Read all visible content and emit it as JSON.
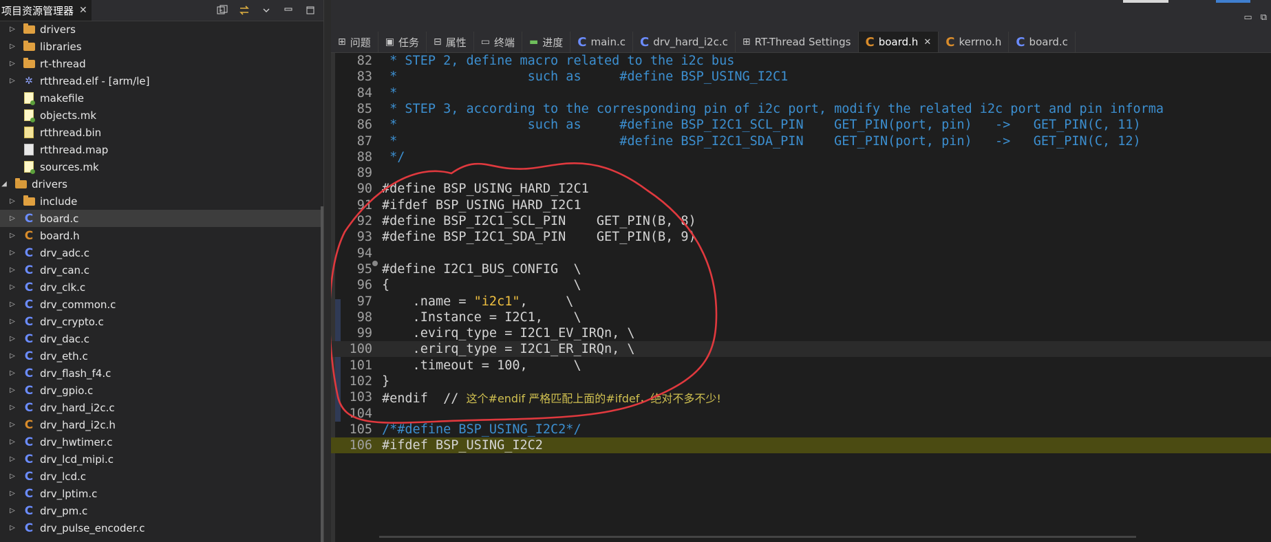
{
  "left_panel": {
    "title": "项目资源管理器",
    "close": "✕",
    "tree": [
      {
        "label": "drivers",
        "icon": "folder-icon",
        "indent": 1,
        "twisty": "▷"
      },
      {
        "label": "libraries",
        "icon": "folder-icon",
        "indent": 1,
        "twisty": "▷"
      },
      {
        "label": "rt-thread",
        "icon": "folder-icon",
        "indent": 1,
        "twisty": "▷"
      },
      {
        "label": "rtthread.elf - [arm/le]",
        "icon": "bug-icon",
        "indent": 1,
        "twisty": "▷"
      },
      {
        "label": "makefile",
        "icon": "makefile-icon",
        "indent": 1,
        "twisty": ""
      },
      {
        "label": "objects.mk",
        "icon": "makefile-icon",
        "indent": 1,
        "twisty": ""
      },
      {
        "label": "rtthread.bin",
        "icon": "bin-file-icon",
        "indent": 1,
        "twisty": ""
      },
      {
        "label": "rtthread.map",
        "icon": "map-file-icon",
        "indent": 1,
        "twisty": ""
      },
      {
        "label": "sources.mk",
        "icon": "makefile-icon",
        "indent": 1,
        "twisty": ""
      },
      {
        "label": "drivers",
        "icon": "folder-open-icon",
        "indent": 0,
        "twisty": "◢"
      },
      {
        "label": "include",
        "icon": "folder-icon",
        "indent": 1,
        "twisty": "▷"
      },
      {
        "label": "board.c",
        "icon": "c-file-icon",
        "indent": 1,
        "twisty": "▷",
        "selected": true
      },
      {
        "label": "board.h",
        "icon": "h-file-icon",
        "indent": 1,
        "twisty": "▷"
      },
      {
        "label": "drv_adc.c",
        "icon": "c-file-icon",
        "indent": 1,
        "twisty": "▷"
      },
      {
        "label": "drv_can.c",
        "icon": "c-file-icon",
        "indent": 1,
        "twisty": "▷"
      },
      {
        "label": "drv_clk.c",
        "icon": "c-file-icon",
        "indent": 1,
        "twisty": "▷"
      },
      {
        "label": "drv_common.c",
        "icon": "c-file-icon",
        "indent": 1,
        "twisty": "▷"
      },
      {
        "label": "drv_crypto.c",
        "icon": "c-file-icon",
        "indent": 1,
        "twisty": "▷"
      },
      {
        "label": "drv_dac.c",
        "icon": "c-file-icon",
        "indent": 1,
        "twisty": "▷"
      },
      {
        "label": "drv_eth.c",
        "icon": "c-file-icon",
        "indent": 1,
        "twisty": "▷"
      },
      {
        "label": "drv_flash_f4.c",
        "icon": "c-file-icon",
        "indent": 1,
        "twisty": "▷"
      },
      {
        "label": "drv_gpio.c",
        "icon": "c-file-icon",
        "indent": 1,
        "twisty": "▷"
      },
      {
        "label": "drv_hard_i2c.c",
        "icon": "c-file-icon",
        "indent": 1,
        "twisty": "▷"
      },
      {
        "label": "drv_hard_i2c.h",
        "icon": "h-file-icon",
        "indent": 1,
        "twisty": "▷"
      },
      {
        "label": "drv_hwtimer.c",
        "icon": "c-file-icon",
        "indent": 1,
        "twisty": "▷"
      },
      {
        "label": "drv_lcd_mipi.c",
        "icon": "c-file-icon",
        "indent": 1,
        "twisty": "▷"
      },
      {
        "label": "drv_lcd.c",
        "icon": "c-file-icon",
        "indent": 1,
        "twisty": "▷"
      },
      {
        "label": "drv_lptim.c",
        "icon": "c-file-icon",
        "indent": 1,
        "twisty": "▷"
      },
      {
        "label": "drv_pm.c",
        "icon": "c-file-icon",
        "indent": 1,
        "twisty": "▷"
      },
      {
        "label": "drv_pulse_encoder.c",
        "icon": "c-file-icon",
        "indent": 1,
        "twisty": "▷"
      }
    ]
  },
  "tabs": [
    {
      "label": "问题",
      "icon": "problems-icon",
      "glyph": "⊞"
    },
    {
      "label": "任务",
      "icon": "tasks-icon",
      "glyph": "▣"
    },
    {
      "label": "属性",
      "icon": "properties-icon",
      "glyph": "⊟"
    },
    {
      "label": "终端",
      "icon": "terminal-icon",
      "glyph": "▭"
    },
    {
      "label": "进度",
      "icon": "progress-icon",
      "glyph": "▬"
    },
    {
      "label": "main.c",
      "icon": "c-file-icon",
      "glyph": "C"
    },
    {
      "label": "drv_hard_i2c.c",
      "icon": "c-file-icon",
      "glyph": "C"
    },
    {
      "label": "RT-Thread Settings",
      "icon": "settings-icon",
      "glyph": "⊞"
    },
    {
      "label": "board.h",
      "icon": "h-file-icon",
      "glyph": "C",
      "active": true,
      "close": "✕"
    },
    {
      "label": "kerrno.h",
      "icon": "h-file-icon",
      "glyph": "C"
    },
    {
      "label": "board.c",
      "icon": "c-file-icon",
      "glyph": "C"
    }
  ],
  "editor": {
    "lines": [
      {
        "num": "82",
        "text": " * STEP 2, define macro related to the i2c bus",
        "type": "comment"
      },
      {
        "num": "83",
        "text": " *                 such as     #define BSP_USING_I2C1",
        "type": "comment"
      },
      {
        "num": "84",
        "text": " *",
        "type": "comment"
      },
      {
        "num": "85",
        "text": " * STEP 3, according to the corresponding pin of i2c port, modify the related i2c port and pin informa",
        "type": "comment"
      },
      {
        "num": "86",
        "text": " *                 such as     #define BSP_I2C1_SCL_PIN    GET_PIN(port, pin)   ->   GET_PIN(C, 11)",
        "type": "comment"
      },
      {
        "num": "87",
        "text": " *                             #define BSP_I2C1_SDA_PIN    GET_PIN(port, pin)   ->   GET_PIN(C, 12)",
        "type": "comment"
      },
      {
        "num": "88",
        "text": " */",
        "type": "comment"
      },
      {
        "num": "89",
        "text": "",
        "type": "code"
      },
      {
        "num": "90",
        "text": "#define BSP_USING_HARD_I2C1",
        "type": "code"
      },
      {
        "num": "91",
        "text": "#ifdef BSP_USING_HARD_I2C1",
        "type": "code"
      },
      {
        "num": "92",
        "text": "#define BSP_I2C1_SCL_PIN    GET_PIN(B, 8)",
        "type": "code"
      },
      {
        "num": "93",
        "text": "#define BSP_I2C1_SDA_PIN    GET_PIN(B, 9)",
        "type": "code"
      },
      {
        "num": "94",
        "text": "",
        "type": "code"
      },
      {
        "num": "95",
        "text": "#define I2C1_BUS_CONFIG  \\",
        "type": "code"
      },
      {
        "num": "96",
        "text": "{                        \\",
        "type": "code"
      },
      {
        "num": "97",
        "text": "    .name = ",
        "str": "\"i2c1\"",
        "after": ",     \\",
        "type": "code"
      },
      {
        "num": "98",
        "text": "    .Instance = I2C1,    \\",
        "type": "code"
      },
      {
        "num": "99",
        "text": "    .evirq_type = I2C1_EV_IRQn, \\",
        "type": "code"
      },
      {
        "num": "100",
        "text": "    .erirq_type = I2C1_ER_IRQn, \\",
        "type": "code",
        "current": true
      },
      {
        "num": "101",
        "text": "    .timeout = 100,      \\",
        "type": "code"
      },
      {
        "num": "102",
        "text": "}",
        "type": "code"
      },
      {
        "num": "103",
        "text": "#endif  // ",
        "cn": "这个#endif 严格匹配上面的#ifdef，绝对不多不少!",
        "type": "code"
      },
      {
        "num": "104",
        "text": "",
        "type": "code"
      },
      {
        "num": "105",
        "text": "/*#define BSP_USING_I2C2*/",
        "type": "comment"
      },
      {
        "num": "106",
        "text": "#ifdef BSP_USING_I2C2",
        "type": "code",
        "yellow": true
      }
    ]
  },
  "colors": {
    "annotation": "#e0393e",
    "accent": "#3f7fd0"
  }
}
